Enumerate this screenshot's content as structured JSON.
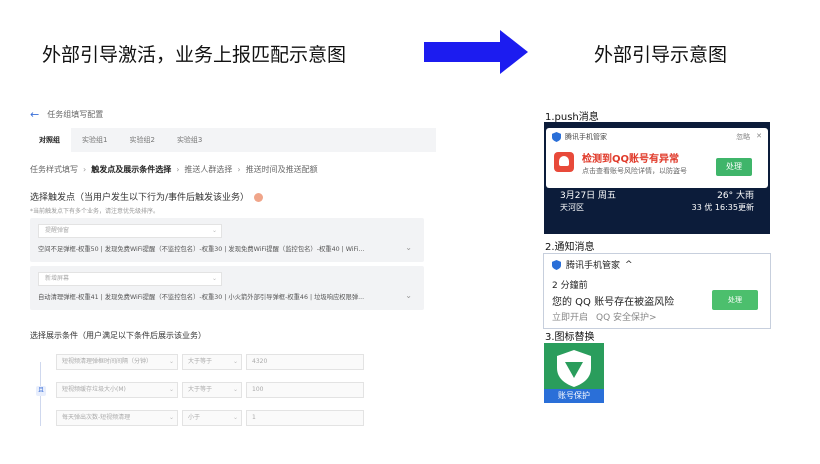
{
  "left_title": "外部引导激活，业务上报匹配示意图",
  "right_title": "外部引导示意图",
  "config_panel": {
    "back_icon": "arrow-left-icon",
    "page_title": "任务组填写配置",
    "tabs": [
      "对照组",
      "实验组1",
      "实验组2",
      "实验组3"
    ],
    "steps": [
      "任务样式填写",
      "触发点及展示条件选择",
      "推送人群选择",
      "推送时间及推送配额"
    ],
    "steps_separator": "›",
    "trigger_title": "选择触发点（当用户发生以下行为/事件后触发该业务）",
    "trigger_hint": "*当前触发点下有多个业务，请注意优先级排序。",
    "trigger_blocks": [
      {
        "placeholder": "提醒弹窗",
        "value": "空间不足弹框-权重50 | 发现免费WiFi提醒（不监控包名）-权重30 | 发现免费WiFi提醒（监控包名）-权重40 | WiFi..."
      },
      {
        "placeholder": "新增屏幕",
        "value": "自动清理弹框-权重41 | 发现免费WiFi提醒（不监控包名）-权重30 | 小火箭外部引导弹框-权重46 | 垃圾响应权限弹..."
      }
    ],
    "display_title": "选择展示条件（用户满足以下条件后展示该业务）",
    "and_label": "且",
    "filters": [
      {
        "field": "短视频清理弹框时间间隔（分钟）",
        "op": "大于等于",
        "value": "4320"
      },
      {
        "field": "短视频缓存垃圾大小(M)",
        "op": "大于等于",
        "value": "100"
      },
      {
        "field": "每天弹出次数-短视频清理",
        "op": "小于",
        "value": "1"
      }
    ]
  },
  "push_example": {
    "label": "1.push消息",
    "app_name": "腾讯手机管家",
    "ignore_label": "忽略",
    "close_icon": "close-icon",
    "headline": "检测到QQ账号有异常",
    "sub": "点击查看账号风险详情，以防盗号",
    "action": "处理",
    "date": "3月27日 周五",
    "place": "天河区",
    "weather": "26° 大雨",
    "aqi": "33 优  16:35更新"
  },
  "notification_example": {
    "label": "2.通知消息",
    "app_name": "腾讯手机管家",
    "expand_icon": "chevron-up-icon",
    "time": "2 分鐘前",
    "message": "您的 QQ 账号存在被盗风险",
    "meta_left": "立即开启",
    "meta_right": "QQ 安全保护>",
    "action": "处理"
  },
  "icon_example": {
    "label": "3.图标替换",
    "band_text": "账号保护"
  },
  "colors": {
    "arrow_blue": "#1c1cf0",
    "accent_blue": "#3a6fd8",
    "alert_red": "#e03a2a",
    "action_green": "#3fb56a",
    "lockscreen_bg": "#0c1c3a"
  }
}
